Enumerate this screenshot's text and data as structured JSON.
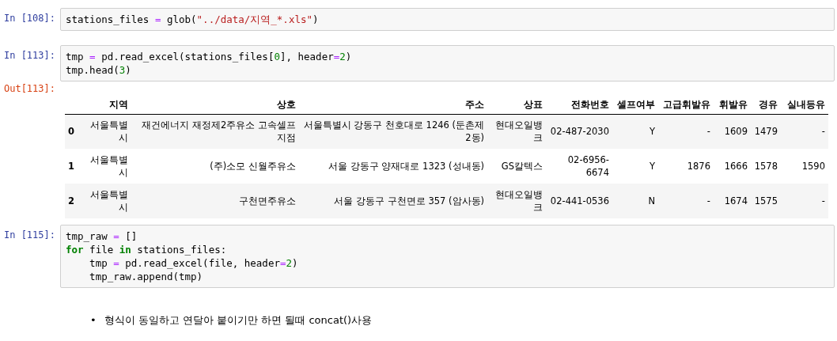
{
  "cells": [
    {
      "kind": "code",
      "prompt": "In [108]:",
      "lines": [
        [
          {
            "kind": "plain",
            "text": "stations_files "
          },
          {
            "kind": "op",
            "text": "="
          },
          {
            "kind": "plain",
            "text": " glob("
          },
          {
            "kind": "string",
            "text": "\"../data/지역_*.xls\""
          },
          {
            "kind": "plain",
            "text": ")"
          }
        ]
      ]
    },
    {
      "kind": "code",
      "prompt": "In [113]:",
      "lines": [
        [
          {
            "kind": "plain",
            "text": "tmp "
          },
          {
            "kind": "op",
            "text": "="
          },
          {
            "kind": "plain",
            "text": " pd.read_excel(stations_files["
          },
          {
            "kind": "number",
            "text": "0"
          },
          {
            "kind": "plain",
            "text": "], header"
          },
          {
            "kind": "op",
            "text": "="
          },
          {
            "kind": "number",
            "text": "2"
          },
          {
            "kind": "plain",
            "text": ")"
          }
        ],
        [
          {
            "kind": "plain",
            "text": "tmp.head("
          },
          {
            "kind": "number",
            "text": "3"
          },
          {
            "kind": "plain",
            "text": ")"
          }
        ]
      ]
    },
    {
      "kind": "output",
      "prompt": "Out[113]:",
      "table": {
        "columns": [
          "",
          "지역",
          "상호",
          "주소",
          "상표",
          "전화번호",
          "셀프여부",
          "고급휘발유",
          "휘발유",
          "경유",
          "실내등유"
        ],
        "rows": [
          [
            "0",
            "서울특별시",
            "재건에너지 재정제2주유소 고속셀프지점",
            "서울특별시 강동구 천호대로 1246 (둔촌제2동)",
            "현대오일뱅크",
            "02-487-2030",
            "Y",
            "-",
            "1609",
            "1479",
            "-"
          ],
          [
            "1",
            "서울특별시",
            "(주)소모 신월주유소",
            "서울 강동구 양재대로 1323 (성내동)",
            "GS칼텍스",
            "02-6956-6674",
            "Y",
            "1876",
            "1666",
            "1578",
            "1590"
          ],
          [
            "2",
            "서울특별시",
            "구천면주유소",
            "서울 강동구 구천면로 357 (암사동)",
            "현대오일뱅크",
            "02-441-0536",
            "N",
            "-",
            "1674",
            "1575",
            "-"
          ]
        ]
      }
    },
    {
      "kind": "code",
      "prompt": "In [115]:",
      "lines": [
        [
          {
            "kind": "plain",
            "text": "tmp_raw "
          },
          {
            "kind": "op",
            "text": "="
          },
          {
            "kind": "plain",
            "text": " []"
          }
        ],
        [
          {
            "kind": "keyword",
            "text": "for"
          },
          {
            "kind": "plain",
            "text": " file "
          },
          {
            "kind": "keyword",
            "text": "in"
          },
          {
            "kind": "plain",
            "text": " stations_files:"
          }
        ],
        [
          {
            "kind": "plain",
            "text": "    tmp "
          },
          {
            "kind": "op",
            "text": "="
          },
          {
            "kind": "plain",
            "text": " pd.read_excel(file, header"
          },
          {
            "kind": "op",
            "text": "="
          },
          {
            "kind": "number",
            "text": "2"
          },
          {
            "kind": "plain",
            "text": ")"
          }
        ],
        [
          {
            "kind": "plain",
            "text": "    tmp_raw.append(tmp)"
          }
        ]
      ]
    },
    {
      "kind": "markdown",
      "bullets": [
        {
          "marker": "•",
          "text": "형식이 동일하고 연달아 붙이기만 하면 될때 concat()사용"
        }
      ]
    }
  ]
}
